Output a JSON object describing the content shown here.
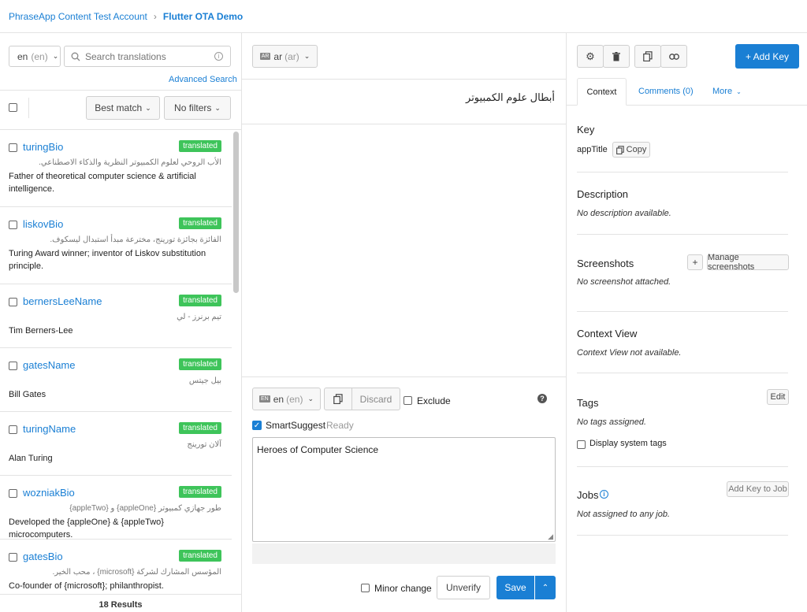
{
  "breadcrumb": {
    "account": "PhraseApp Content Test Account",
    "project": "Flutter OTA Demo"
  },
  "left": {
    "locale": "en",
    "locale_code": "(en)",
    "search_placeholder": "Search translations",
    "advanced_search": "Advanced Search",
    "sort": "Best match",
    "filters": "No filters",
    "results": "18 Results",
    "badge": "translated",
    "keys": [
      {
        "name": "turingBio",
        "ar": "الأب الروحي لعلوم الكمبيوتر النظرية والذكاء الاصطناعي.",
        "en": "Father of theoretical computer science & artificial intelligence."
      },
      {
        "name": "liskovBio",
        "ar": "الفائزة بجائزة تورينج، مخترعة مبدأ استبدال ليسكوف.",
        "en": "Turing Award winner; inventor of Liskov substitution principle."
      },
      {
        "name": "bernersLeeName",
        "ar": "تيم برنرز - لي",
        "en": "Tim Berners-Lee"
      },
      {
        "name": "gatesName",
        "ar": "بيل جيتس",
        "en": "Bill Gates"
      },
      {
        "name": "turingName",
        "ar": "آلان تورينج",
        "en": "Alan Turing"
      },
      {
        "name": "wozniakBio",
        "ar": "طور جهازي كمبيوتر {appleOne} و {appleTwo}",
        "en": "Developed the {appleOne} & {appleTwo} microcomputers."
      },
      {
        "name": "gatesBio",
        "ar": "المؤسس المشارك لشركة {microsoft} ، محب الخير.",
        "en": "Co-founder of {microsoft}; philanthropist."
      }
    ]
  },
  "middle": {
    "target_locale": "ar",
    "target_code": "(ar)",
    "target_text": "أبطال علوم الكمبيوتر",
    "source_locale": "en",
    "source_code": "(en)",
    "discard": "Discard",
    "exclude": "Exclude",
    "smartsuggest": "SmartSuggest",
    "smartsuggest_status": "Ready",
    "source_text": "Heroes of Computer Science",
    "minor_change": "Minor change",
    "unverify": "Unverify",
    "save": "Save"
  },
  "right": {
    "add_key": "+ Add Key",
    "tabs": {
      "context": "Context",
      "comments": "Comments (0)",
      "more": "More"
    },
    "key_title": "Key",
    "key_value": "appTitle",
    "copy": "Copy",
    "description_title": "Description",
    "description_value": "No description available.",
    "screenshots_title": "Screenshots",
    "manage_screenshots": "Manage screenshots",
    "screenshots_value": "No screenshot attached.",
    "plus": "+",
    "context_view_title": "Context View",
    "context_view_value": "Context View not available.",
    "tags_title": "Tags",
    "edit": "Edit",
    "tags_value": "No tags assigned.",
    "display_system_tags": "Display system tags",
    "jobs_title": "Jobs",
    "add_key_to_job": "Add Key to Job",
    "jobs_value": "Not assigned to any job."
  }
}
